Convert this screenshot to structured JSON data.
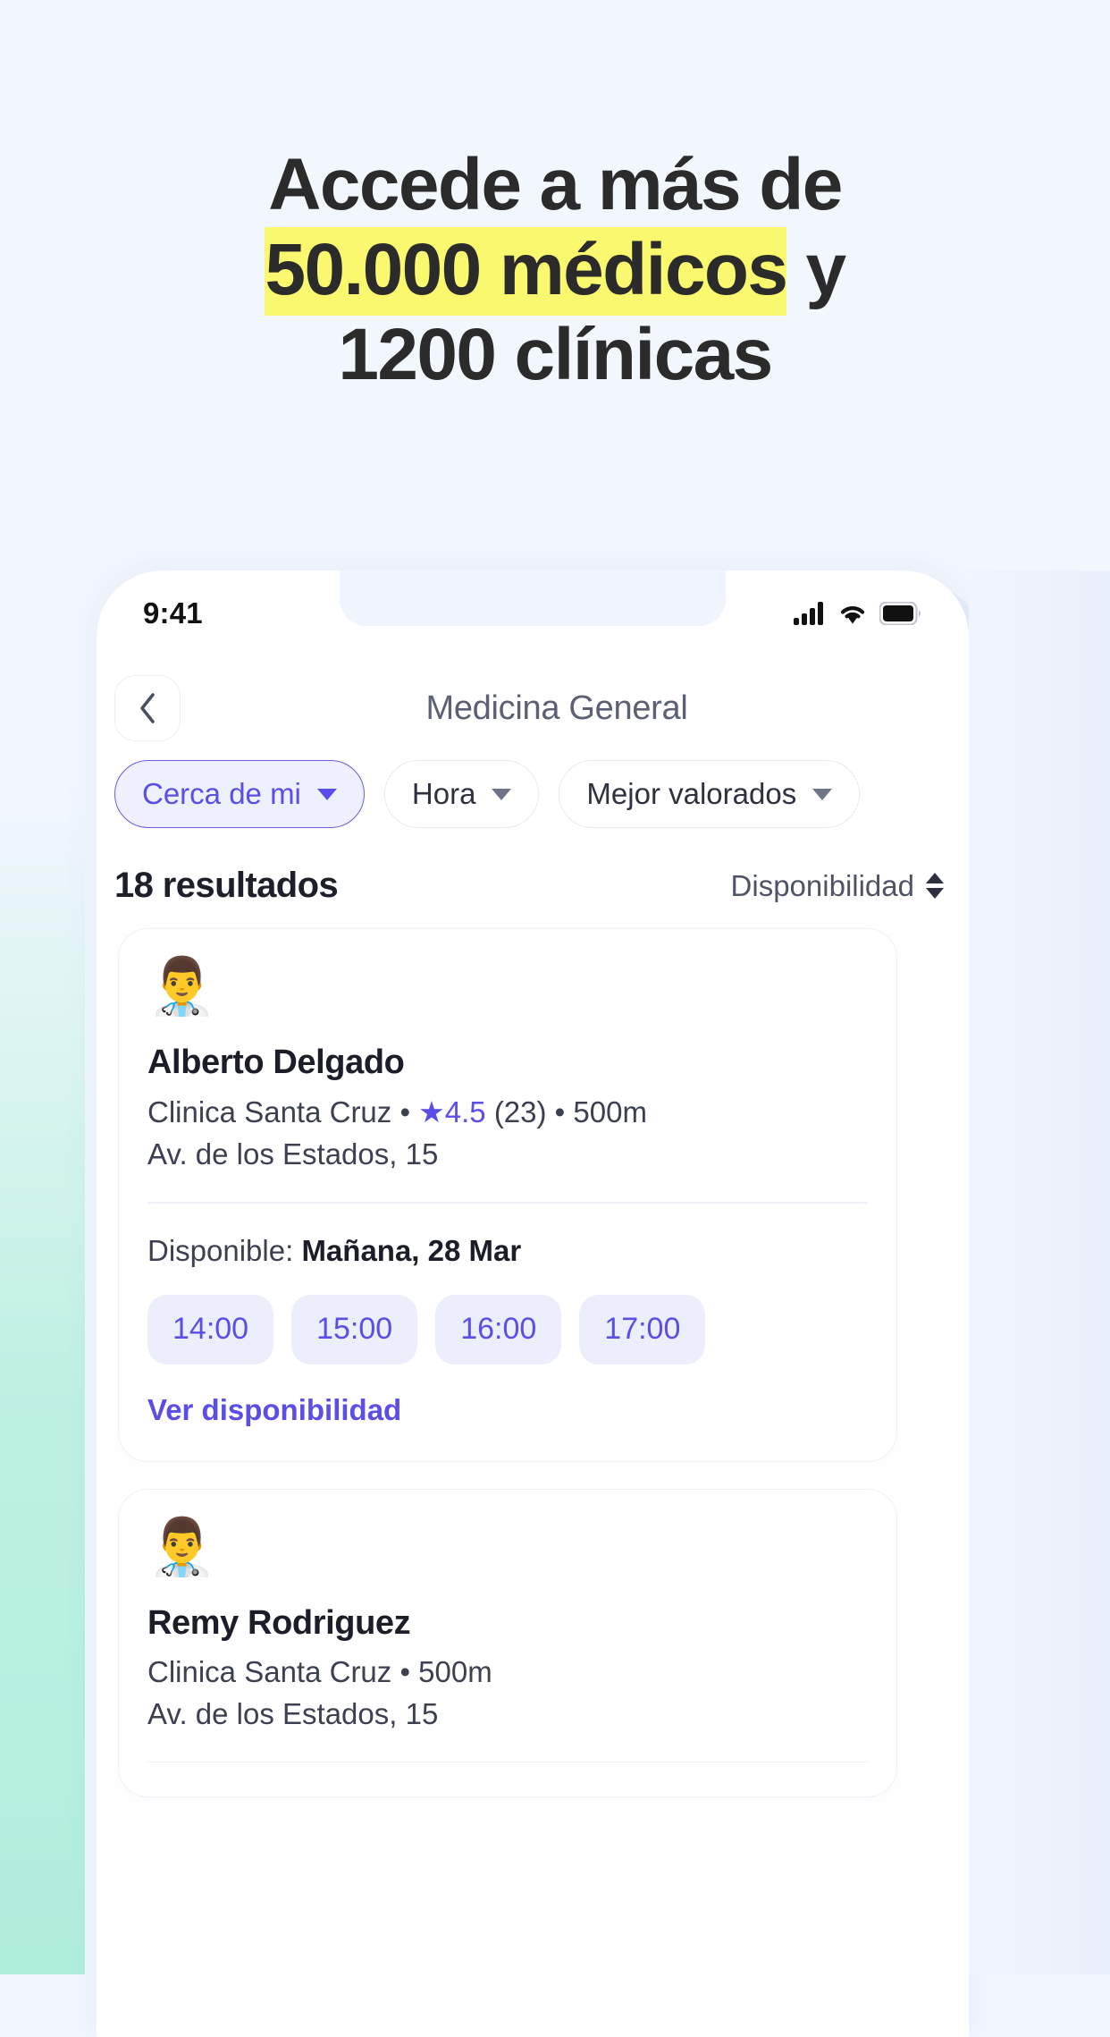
{
  "headline": {
    "line1": "Accede a más de",
    "line2_highlight": "50.000 médicos",
    "line2_rest": " y",
    "line3": "1200 clínicas",
    "highlight_color": "#faf86e",
    "text_color": "#2b2b2b"
  },
  "phone": {
    "status": {
      "time": "9:41",
      "cellular_icon": "signal-bars-icon",
      "wifi_icon": "wifi-icon",
      "battery_icon": "battery-full-icon"
    },
    "nav": {
      "back_icon": "chevron-left-icon",
      "title": "Medicina General"
    },
    "filters": [
      {
        "label": "Cerca de mi",
        "active": true,
        "caret_icon": "chevron-down-icon"
      },
      {
        "label": "Hora",
        "active": false,
        "caret_icon": "chevron-down-icon"
      },
      {
        "label": "Mejor valorados",
        "active": false,
        "caret_icon": "chevron-down-icon"
      }
    ],
    "results": {
      "count_label": "18 resultados",
      "sort_label": "Disponibilidad",
      "sort_icon": "sort-updown-icon"
    },
    "cards": [
      {
        "avatar_icon": "man-health-worker-emoji",
        "avatar_glyph": "👨‍⚕️",
        "name": "Alberto Delgado",
        "clinic": "Clinica Santa Cruz",
        "sep1": " • ",
        "star_icon": "star-icon",
        "star_glyph": "★",
        "rating": "4.5",
        "reviews": "(23)",
        "sep2": " • ",
        "distance": "500m",
        "address": "Av. de los Estados, 15",
        "availability_prefix": "Disponible: ",
        "availability_date": "Mañana, 28 Mar",
        "slots": [
          "14:00",
          "15:00",
          "16:00",
          "17:00"
        ],
        "link_label": "Ver disponibilidad"
      },
      {
        "avatar_icon": "man-health-worker-emoji",
        "avatar_glyph": "👨‍⚕️",
        "name": "Remy Rodriguez",
        "clinic": "Clinica Santa Cruz",
        "sep1": " • ",
        "star_icon": "",
        "star_glyph": "",
        "rating": "",
        "reviews": "",
        "sep2": "",
        "distance": "500m",
        "address": "Av. de los Estados, 15",
        "availability_prefix": "",
        "availability_date": "",
        "slots": [],
        "link_label": ""
      }
    ]
  },
  "theme": {
    "accent": "#5b4de8",
    "page_bg": "#f2f6fd",
    "mint": "#b0eede",
    "card_bg": "#ffffff",
    "slot_bg": "#eceefc"
  }
}
